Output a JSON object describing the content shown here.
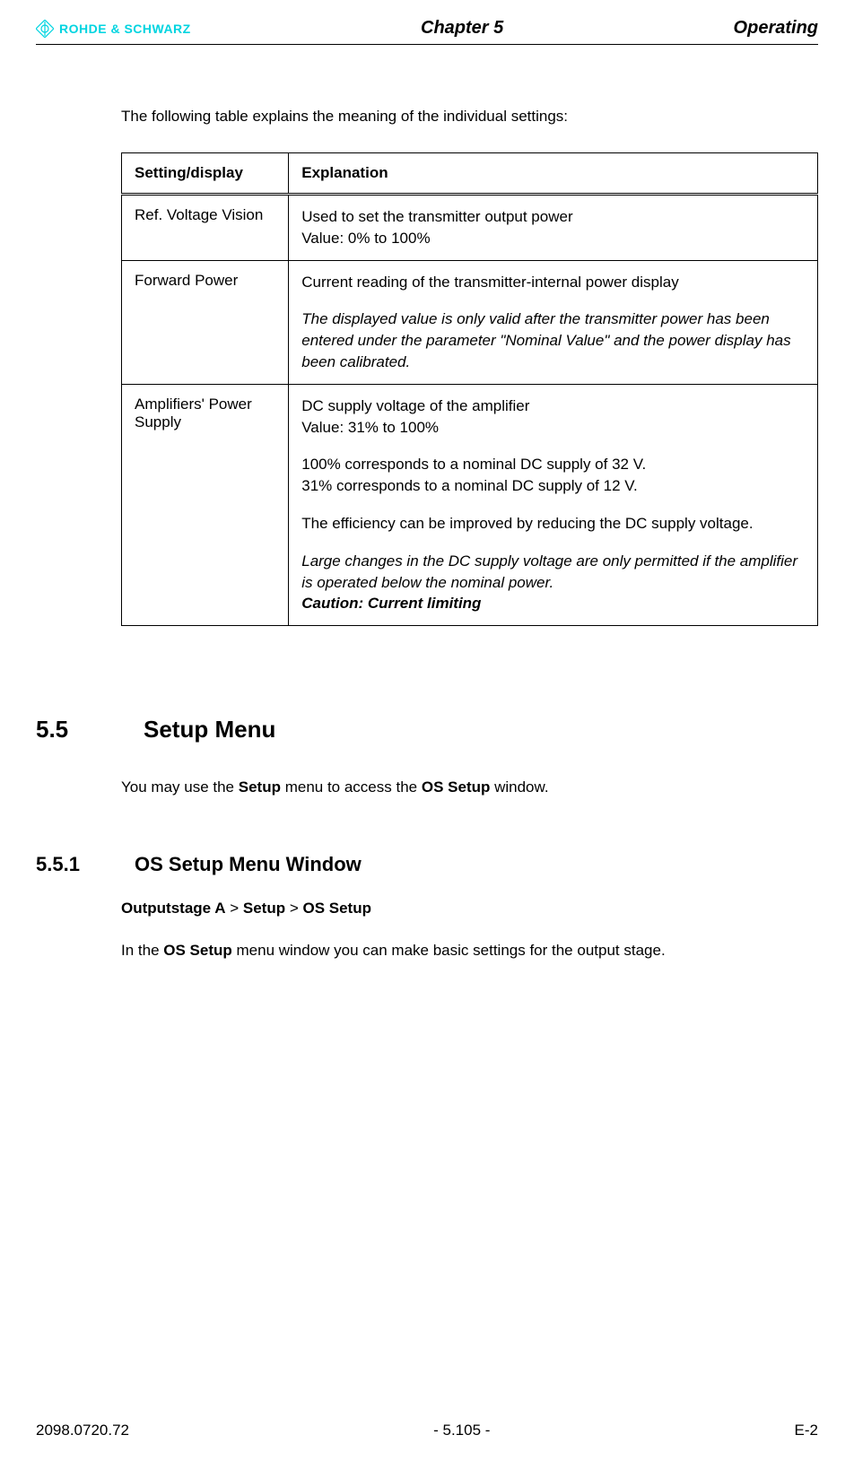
{
  "header": {
    "logo_text": "ROHDE & SCHWARZ",
    "chapter": "Chapter 5",
    "section": "Operating"
  },
  "intro": "The following table explains the meaning of the individual settings:",
  "table": {
    "headers": {
      "setting": "Setting/display",
      "explanation": "Explanation"
    },
    "rows": [
      {
        "setting": "Ref. Voltage Vision",
        "p1": "Used to set the transmitter output power",
        "p1b": "Value: 0% to 100%"
      },
      {
        "setting": "Forward Power",
        "p1": "Current reading of the transmitter-internal power display",
        "p2": "The displayed value is only valid after the transmitter power has been entered under the parameter \"Nominal Value\" and the power display has been calibrated."
      },
      {
        "setting": "Amplifiers' Power Supply",
        "p1": "DC supply voltage of the amplifier",
        "p1b": "Value: 31% to 100%",
        "p2": "100% corresponds to a nominal DC supply of 32 V.",
        "p2b": "31% corresponds to a nominal DC supply of 12 V.",
        "p3": "The efficiency can be improved by reducing the DC supply voltage.",
        "p4": "Large changes in the DC supply voltage are only permitted if the amplifier is operated below the nominal power.",
        "p5": "Caution: Current limiting"
      }
    ]
  },
  "section55": {
    "number": "5.5",
    "title": "Setup Menu",
    "text_pre": "You may use the ",
    "text_bold1": "Setup",
    "text_mid": " menu to access the ",
    "text_bold2": "OS Setup",
    "text_post": " window."
  },
  "section551": {
    "number": "5.5.1",
    "title": "OS Setup Menu Window",
    "bc_a": "Outputstage A",
    "bc_sep1": " > ",
    "bc_b": "Setup",
    "bc_sep2": " > ",
    "bc_c": "OS Setup",
    "text_pre": "In the ",
    "text_bold": "OS Setup",
    "text_post": " menu window you can make basic settings for the output stage."
  },
  "footer": {
    "left": "2098.0720.72",
    "center": "- 5.105 -",
    "right": "E-2"
  }
}
